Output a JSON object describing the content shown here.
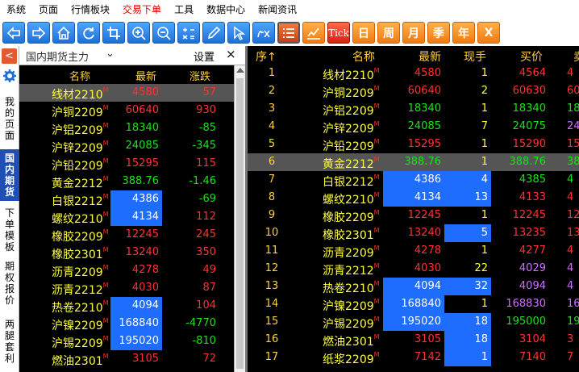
{
  "menu": [
    "系统",
    "页面",
    "行情板块",
    "交易下单",
    "工具",
    "数据中心",
    "新闻资讯"
  ],
  "menu_active_index": 3,
  "toolbar": {
    "tick_label": "Tick",
    "period_labels": [
      "日",
      "周",
      "月",
      "季",
      "年"
    ],
    "close_label": "X"
  },
  "sidebar": {
    "collapse_label": "<",
    "tabs": [
      {
        "label": "我的页面",
        "active": false
      },
      {
        "label": "国内期货",
        "active": true
      },
      {
        "label": "下单模板",
        "active": false
      },
      {
        "label": "期权报价",
        "active": false
      },
      {
        "label": "两腿套利",
        "active": false
      }
    ]
  },
  "left_panel": {
    "title": "国内期货主力",
    "dropdown": "⌄",
    "settings_label": "设置",
    "close_label": "×",
    "columns": [
      "名称",
      "最新",
      "涨跌"
    ],
    "rows": [
      {
        "name": "线材2210",
        "mark": "M",
        "price": "4580",
        "price_color": "red",
        "price_bg": false,
        "change": "57",
        "change_color": "red",
        "highlight": true
      },
      {
        "name": "沪铜2209",
        "mark": "M",
        "price": "60640",
        "price_color": "red",
        "price_bg": false,
        "change": "930",
        "change_color": "red",
        "highlight": false
      },
      {
        "name": "沪铝2209",
        "mark": "M",
        "price": "18340",
        "price_color": "green",
        "price_bg": false,
        "change": "-85",
        "change_color": "green",
        "highlight": false
      },
      {
        "name": "沪锌2209",
        "mark": "M",
        "price": "24085",
        "price_color": "green",
        "price_bg": false,
        "change": "-345",
        "change_color": "green",
        "highlight": false
      },
      {
        "name": "沪铅2209",
        "mark": "M",
        "price": "15295",
        "price_color": "red",
        "price_bg": false,
        "change": "115",
        "change_color": "red",
        "highlight": false
      },
      {
        "name": "黄金2212",
        "mark": "M",
        "price": "388.76",
        "price_color": "green",
        "price_bg": false,
        "change": "-1.46",
        "change_color": "green",
        "highlight": false
      },
      {
        "name": "白银2212",
        "mark": "M",
        "price": "4386",
        "price_color": "white",
        "price_bg": true,
        "change": "-69",
        "change_color": "green",
        "highlight": false
      },
      {
        "name": "螺纹2210",
        "mark": "M",
        "price": "4134",
        "price_color": "white",
        "price_bg": true,
        "change": "112",
        "change_color": "red",
        "highlight": false
      },
      {
        "name": "橡胶2209",
        "mark": "M",
        "price": "12245",
        "price_color": "red",
        "price_bg": false,
        "change": "245",
        "change_color": "red",
        "highlight": false
      },
      {
        "name": "橡胶2301",
        "mark": "M",
        "price": "13240",
        "price_color": "red",
        "price_bg": false,
        "change": "350",
        "change_color": "red",
        "highlight": false
      },
      {
        "name": "沥青2209",
        "mark": "M",
        "price": "4278",
        "price_color": "red",
        "price_bg": false,
        "change": "49",
        "change_color": "red",
        "highlight": false
      },
      {
        "name": "沥青2212",
        "mark": "M",
        "price": "4030",
        "price_color": "red",
        "price_bg": false,
        "change": "87",
        "change_color": "red",
        "highlight": false
      },
      {
        "name": "热卷2210",
        "mark": "M",
        "price": "4094",
        "price_color": "white",
        "price_bg": true,
        "change": "104",
        "change_color": "red",
        "highlight": false
      },
      {
        "name": "沪镍2209",
        "mark": "M",
        "price": "168840",
        "price_color": "white",
        "price_bg": true,
        "change": "-4770",
        "change_color": "green",
        "highlight": false
      },
      {
        "name": "沪锡2209",
        "mark": "M",
        "price": "195020",
        "price_color": "white",
        "price_bg": true,
        "change": "-810",
        "change_color": "green",
        "highlight": false
      },
      {
        "name": "燃油2301",
        "mark": "M",
        "price": "3105",
        "price_color": "red",
        "price_bg": false,
        "change": "72",
        "change_color": "red",
        "highlight": false
      }
    ]
  },
  "right_panel": {
    "columns": [
      "序↑",
      "名称",
      "最新",
      "现手",
      "买价",
      "卖"
    ],
    "rows": [
      {
        "idx": "1",
        "name": "线材2210",
        "mark": "M",
        "price": "4580",
        "price_color": "red",
        "price_bg": false,
        "vol": "1",
        "vol_bg": false,
        "bid": "4564",
        "bid_color": "red",
        "ext": "4",
        "ext_color": "red",
        "highlight": false
      },
      {
        "idx": "2",
        "name": "沪铜2209",
        "mark": "M",
        "price": "60640",
        "price_color": "red",
        "price_bg": false,
        "vol": "2",
        "vol_bg": false,
        "bid": "60630",
        "bid_color": "red",
        "ext": "60",
        "ext_color": "red",
        "highlight": false
      },
      {
        "idx": "3",
        "name": "沪铝2209",
        "mark": "M",
        "price": "18340",
        "price_color": "green",
        "price_bg": false,
        "vol": "1",
        "vol_bg": false,
        "bid": "18340",
        "bid_color": "green",
        "ext": "18",
        "ext_color": "green",
        "highlight": false
      },
      {
        "idx": "4",
        "name": "沪锌2209",
        "mark": "M",
        "price": "24085",
        "price_color": "green",
        "price_bg": false,
        "vol": "7",
        "vol_bg": false,
        "bid": "24075",
        "bid_color": "green",
        "ext": "24",
        "ext_color": "purple",
        "highlight": false
      },
      {
        "idx": "5",
        "name": "沪铅2209",
        "mark": "M",
        "price": "15295",
        "price_color": "red",
        "price_bg": false,
        "vol": "1",
        "vol_bg": false,
        "bid": "15290",
        "bid_color": "red",
        "ext": "15",
        "ext_color": "red",
        "highlight": false
      },
      {
        "idx": "6",
        "name": "黄金2212",
        "mark": "M",
        "price": "388.76",
        "price_color": "green",
        "price_bg": false,
        "vol": "1",
        "vol_bg": false,
        "bid": "388.76",
        "bid_color": "green",
        "ext": "38",
        "ext_color": "green",
        "highlight": true
      },
      {
        "idx": "7",
        "name": "白银2212",
        "mark": "M",
        "price": "4386",
        "price_color": "white",
        "price_bg": true,
        "vol": "4",
        "vol_bg": true,
        "bid": "4385",
        "bid_color": "green",
        "ext": "4",
        "ext_color": "green",
        "highlight": false
      },
      {
        "idx": "8",
        "name": "螺纹2210",
        "mark": "M",
        "price": "4134",
        "price_color": "white",
        "price_bg": true,
        "vol": "13",
        "vol_bg": true,
        "bid": "4133",
        "bid_color": "red",
        "ext": "4",
        "ext_color": "red",
        "highlight": false
      },
      {
        "idx": "9",
        "name": "橡胶2209",
        "mark": "M",
        "price": "12245",
        "price_color": "red",
        "price_bg": false,
        "vol": "1",
        "vol_bg": false,
        "bid": "12245",
        "bid_color": "red",
        "ext": "12",
        "ext_color": "red",
        "highlight": false
      },
      {
        "idx": "10",
        "name": "橡胶2301",
        "mark": "M",
        "price": "13240",
        "price_color": "red",
        "price_bg": false,
        "vol": "5",
        "vol_bg": true,
        "bid": "13235",
        "bid_color": "red",
        "ext": "13",
        "ext_color": "red",
        "highlight": false
      },
      {
        "idx": "11",
        "name": "沥青2209",
        "mark": "M",
        "price": "4278",
        "price_color": "red",
        "price_bg": false,
        "vol": "1",
        "vol_bg": false,
        "bid": "4277",
        "bid_color": "red",
        "ext": "4",
        "ext_color": "red",
        "highlight": false
      },
      {
        "idx": "12",
        "name": "沥青2212",
        "mark": "M",
        "price": "4030",
        "price_color": "red",
        "price_bg": false,
        "vol": "22",
        "vol_bg": false,
        "bid": "4029",
        "bid_color": "purple",
        "ext": "4",
        "ext_color": "purple",
        "highlight": false
      },
      {
        "idx": "13",
        "name": "热卷2210",
        "mark": "M",
        "price": "4094",
        "price_color": "white",
        "price_bg": true,
        "vol": "32",
        "vol_bg": true,
        "bid": "4094",
        "bid_color": "purple",
        "ext": "4",
        "ext_color": "purple",
        "highlight": false
      },
      {
        "idx": "14",
        "name": "沪镍2209",
        "mark": "M",
        "price": "168840",
        "price_color": "white",
        "price_bg": true,
        "vol": "1",
        "vol_bg": false,
        "bid": "168830",
        "bid_color": "purple",
        "ext": "16",
        "ext_color": "purple",
        "highlight": false
      },
      {
        "idx": "15",
        "name": "沪锡2209",
        "mark": "M",
        "price": "195020",
        "price_color": "white",
        "price_bg": true,
        "vol": "18",
        "vol_bg": true,
        "bid": "195000",
        "bid_color": "green",
        "ext": "19",
        "ext_color": "green",
        "highlight": false
      },
      {
        "idx": "16",
        "name": "燃油2301",
        "mark": "M",
        "price": "3105",
        "price_color": "red",
        "price_bg": false,
        "vol": "18",
        "vol_bg": true,
        "bid": "3104",
        "bid_color": "red",
        "ext": "3",
        "ext_color": "red",
        "highlight": false
      },
      {
        "idx": "17",
        "name": "纸浆2209",
        "mark": "M",
        "price": "7142",
        "price_color": "red",
        "price_bg": false,
        "vol": "1",
        "vol_bg": true,
        "bid": "7140",
        "bid_color": "red",
        "ext": "7",
        "ext_color": "red",
        "highlight": false
      }
    ]
  }
}
